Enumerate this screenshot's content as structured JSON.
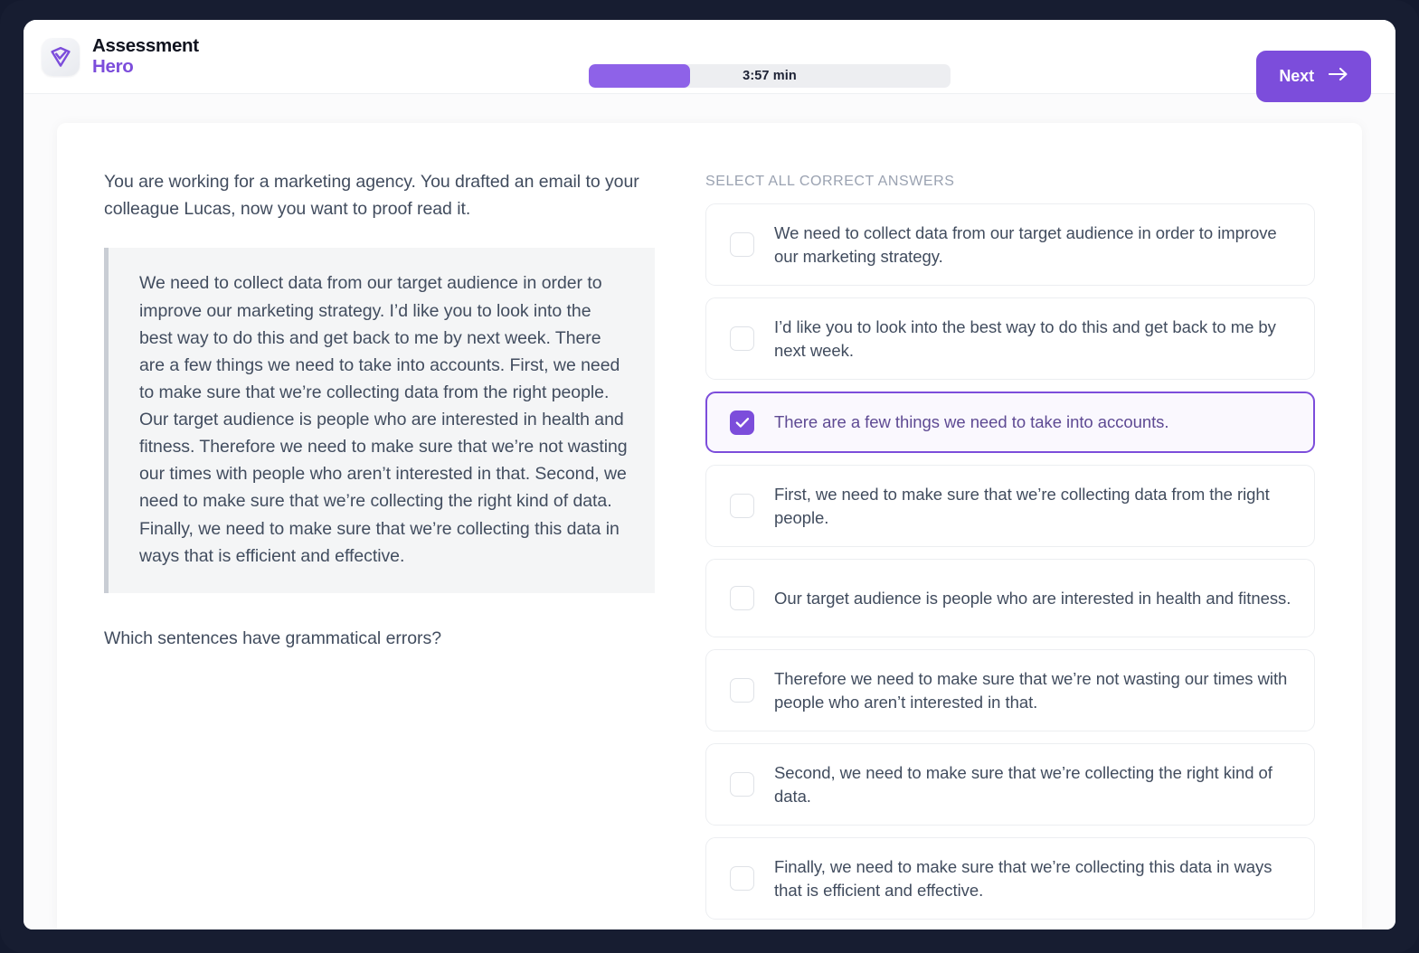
{
  "brand": {
    "line1": "Assessment",
    "line2": "Hero",
    "logo_icon": "shield-check-icon"
  },
  "header": {
    "timer_label": "3:57 min",
    "timer_progress_percent": 28,
    "next_label": "Next",
    "next_icon": "arrow-right-icon",
    "accent_color": "#7c4ddb",
    "timer_fill_color": "#8e62e8",
    "timer_track_color": "#edeef1"
  },
  "left": {
    "prompt": "You are working for a marketing agency. You drafted an email to your colleague Lucas, now you want to proof read it.",
    "email_quote": "We need to collect data from our target audience in order to improve our marketing strategy. I’d like you to look into the best way to do this and get back to me by next week. There are a few things we need to take into accounts. First, we need to make sure that we’re collecting data from the right people. Our target audience is people who are interested in health and fitness. Therefore we need to make sure that we’re not wasting our times with people who aren’t interested in that. Second, we need to make sure that we’re collecting the right kind of data. Finally, we need to make sure that we’re collecting this data in ways that is efficient and effective.",
    "question": "Which sentences have grammatical errors?"
  },
  "right": {
    "title": "SELECT ALL CORRECT ANSWERS",
    "options": [
      {
        "label": "We need to collect data from our target audience in order to improve our marketing strategy.",
        "selected": false
      },
      {
        "label": "I’d like you to look into the best way to do this and get back to me by next week.",
        "selected": false
      },
      {
        "label": "There are a few things we need to take into accounts.",
        "selected": true
      },
      {
        "label": "First, we need to make sure that we’re collecting data from the right people.",
        "selected": false
      },
      {
        "label": "Our target audience is people who are interested in health and fitness.",
        "selected": false
      },
      {
        "label": "Therefore we need to make sure that we’re not wasting our times with people who aren’t interested in that.",
        "selected": false
      },
      {
        "label": "Second, we need to make sure that we’re collecting the right kind of data.",
        "selected": false
      },
      {
        "label": "Finally, we need to make sure that we’re collecting this data in ways that is efficient and effective.",
        "selected": false
      }
    ]
  }
}
